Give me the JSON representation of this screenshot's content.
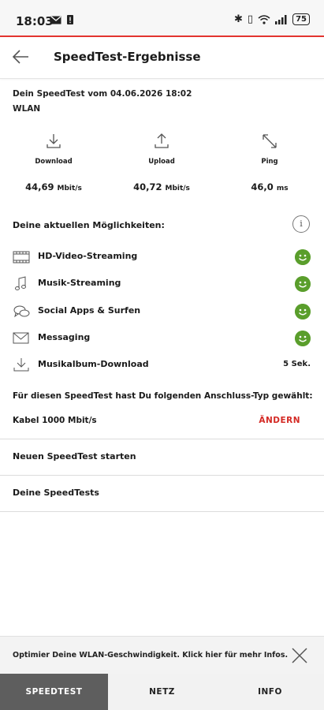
{
  "status_bar": {
    "time": "18:03",
    "battery": "75"
  },
  "header": {
    "title": "SpeedTest-Ergebnisse"
  },
  "test_info": {
    "date_line": "Dein SpeedTest vom 04.06.2026 18:02",
    "connection": "WLAN"
  },
  "metrics": [
    {
      "label": "Download",
      "value": "44,69",
      "unit": "Mbit/s",
      "icon": "download-icon"
    },
    {
      "label": "Upload",
      "value": "40,72",
      "unit": "Mbit/s",
      "icon": "upload-icon"
    },
    {
      "label": "Ping",
      "value": "46,0",
      "unit": "ms",
      "icon": "ping-icon"
    }
  ],
  "possibilities": {
    "title": "Deine aktuellen Möglichkeiten:",
    "items": [
      {
        "label": "HD-Video-Streaming",
        "icon": "film-icon",
        "status": "smiley"
      },
      {
        "label": "Musik-Streaming",
        "icon": "music-note-icon",
        "status": "smiley"
      },
      {
        "label": "Social Apps & Surfen",
        "icon": "chat-bubbles-icon",
        "status": "smiley"
      },
      {
        "label": "Messaging",
        "icon": "envelope-icon",
        "status": "smiley"
      },
      {
        "label": "Musikalbum-Download",
        "icon": "download-icon",
        "value": "5 Sek."
      }
    ]
  },
  "connection_type": {
    "note": "Für diesen SpeedTest hast Du folgenden Anschluss-Typ gewählt:",
    "value": "Kabel 1000 Mbit/s",
    "change_label": "ÄNDERN"
  },
  "actions": {
    "new_test": "Neuen SpeedTest starten",
    "my_tests": "Deine SpeedTests"
  },
  "banner": {
    "text": "Optimier Deine WLAN-Geschwindigkeit. Klick hier für mehr Infos."
  },
  "tabs": [
    {
      "label": "SPEEDTEST",
      "active": true
    },
    {
      "label": "NETZ"
    },
    {
      "label": "INFO"
    }
  ],
  "colors": {
    "accent": "#e3342f",
    "smiley": "#5a9e2c",
    "active_tab": "#5e5e5e"
  }
}
